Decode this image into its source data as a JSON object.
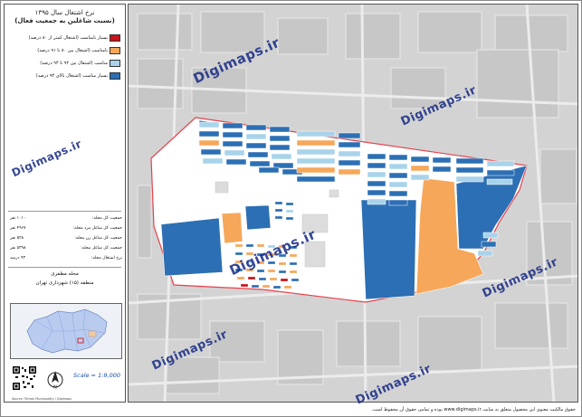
{
  "title": {
    "line1": "نرخ اشتغال سال ۱۳۹۵",
    "line2": "(نسبت شاغلین به جمعیت فعال)"
  },
  "legend": [
    {
      "label": "بسیار نامناسب (اشتغال کمتر از ۸۰ درصد)",
      "color": "#c8131b"
    },
    {
      "label": "نامناسب (اشتغال بین ۸۰ تا ۹۱ درصد)",
      "color": "#f6a75a"
    },
    {
      "label": "مناسب (اشتغال بین ۹۲ تا ۹۴ درصد)",
      "color": "#a9d3ea"
    },
    {
      "label": "بسیار مناسب (اشتغال بالای ۹۴ درصد)",
      "color": "#2c6fb4"
    }
  ],
  "stats": [
    {
      "label": "جمعیت کل محله:",
      "value": "۱۰۱۰ نفر"
    },
    {
      "label": "جمعیت کل شاغل مرد محله:",
      "value": "۴۹۶۷ نفر"
    },
    {
      "label": "جمعیت کل شاغل زن محله:",
      "value": "۵۲۸ نفر"
    },
    {
      "label": "جمعیت کل شاغل محله:",
      "value": "۵۳۹۸ نفر"
    },
    {
      "label": "نرخ اشتغال محله:",
      "value": "۹۳ درصد"
    }
  ],
  "location": {
    "neighborhood": "محله مظفری",
    "district": "منطقه (۱۵) شهرداری تهران"
  },
  "scale": "Scale = 1:9,000",
  "tiny_credit": "Source: Tehran Municipality / Digimaps",
  "footer": "حقوق مالکیت معنوی این محصول متعلق به سایت www.digimaps.ir بوده و تمامی حقوق آن محفوظ است.",
  "watermark": "Digimaps.ir",
  "colors": {
    "very_poor": "#c8131b",
    "poor": "#f6a75a",
    "good": "#a9d3ea",
    "very_good": "#2c6fb4",
    "boundary": "#e8414a"
  }
}
